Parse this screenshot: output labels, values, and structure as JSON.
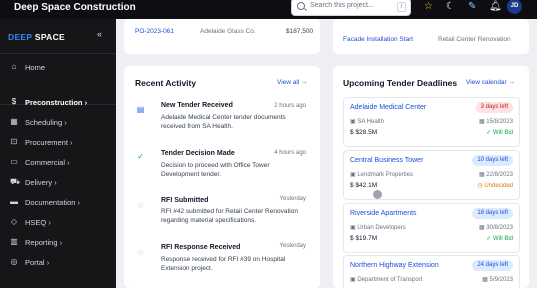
{
  "header": {
    "title": "Deep Space Construction",
    "search_placeholder": "Search this project...",
    "search_shortcut": "/",
    "avatar_initials": "JD"
  },
  "sidebar": {
    "brand_part1": "DEEP",
    "brand_part2": "SPACE",
    "collapse_glyph": "«",
    "items": [
      {
        "label": "Home",
        "icon": "home-icon",
        "glyph": "⌂"
      },
      {
        "label": "Preconstruction",
        "icon": "dollar-icon",
        "glyph": "$"
      },
      {
        "label": "Scheduling",
        "icon": "calendar-icon",
        "glyph": "▦"
      },
      {
        "label": "Procurement",
        "icon": "cart-icon",
        "glyph": "⊡"
      },
      {
        "label": "Commercial",
        "icon": "document-icon",
        "glyph": "▭"
      },
      {
        "label": "Delivery",
        "icon": "truck-icon",
        "glyph": "⛟"
      },
      {
        "label": "Documentation",
        "icon": "folder-icon",
        "glyph": "▬"
      },
      {
        "label": "HSEQ",
        "icon": "shield-icon",
        "glyph": "◇"
      },
      {
        "label": "Reporting",
        "icon": "chart-icon",
        "glyph": "▥"
      },
      {
        "label": "Portal",
        "icon": "globe-icon",
        "glyph": "◎"
      }
    ],
    "chevron": "›"
  },
  "top_cards": {
    "left": {
      "po": "PO-2023-061",
      "supplier": "Adelaide Glass Co.",
      "amount": "$187,500"
    },
    "right": {
      "item": "Facade Installation Start",
      "project": "Retail Center Renovation"
    }
  },
  "recent_activity": {
    "title": "Recent Activity",
    "view_all": "View all →",
    "items": [
      {
        "title": "New Tender Received",
        "time": "2 hours ago",
        "desc": "Adelaide Medical Center tender documents received from SA Health.",
        "icon": "document-icon",
        "color": "#2563eb"
      },
      {
        "title": "Tender Decision Made",
        "time": "4 hours ago",
        "desc": "Decision to proceed with Office Tower Development tender.",
        "icon": "check-circle-icon",
        "color": "#16a34a"
      },
      {
        "title": "RFI Submitted",
        "time": "Yesterday",
        "desc": "RFI #42 submitted for Retail Center Renovation regarding material specifications.",
        "icon": "message-icon",
        "color": "#9333ea"
      },
      {
        "title": "RFI Response Received",
        "time": "Yesterday",
        "desc": "Response received for RFI #39 on Hospital Extension project.",
        "icon": "message-icon",
        "color": "#9333ea"
      }
    ]
  },
  "tenders": {
    "title": "Upcoming Tender Deadlines",
    "view_calendar": "View calendar →",
    "items": [
      {
        "name": "Adelaide Medical Center",
        "badge": "3 days left",
        "badge_color": "red",
        "client": "SA Health",
        "date": "15/8/2023",
        "value": "$28.5M",
        "status": "Will Bid",
        "status_color": "green"
      },
      {
        "name": "Central Business Tower",
        "badge": "10 days left",
        "badge_color": "blue",
        "client": "Lendmark Properties",
        "date": "22/8/2023",
        "value": "$42.1M",
        "status": "Undecided",
        "status_color": "orange"
      },
      {
        "name": "Riverside Apartments",
        "badge": "18 days left",
        "badge_color": "blue",
        "client": "Urban Developers",
        "date": "30/8/2023",
        "value": "$19.7M",
        "status": "Will Bid",
        "status_color": "green"
      },
      {
        "name": "Northern Highway Extension",
        "badge": "24 days left",
        "badge_color": "blue",
        "client": "Department of Transport",
        "date": "5/9/2023",
        "value": "",
        "status": "",
        "status_color": "green"
      }
    ]
  },
  "colors": {
    "accent": "#1d4ed8",
    "topbar": "#0d0d12",
    "sidebar": "#161619"
  }
}
